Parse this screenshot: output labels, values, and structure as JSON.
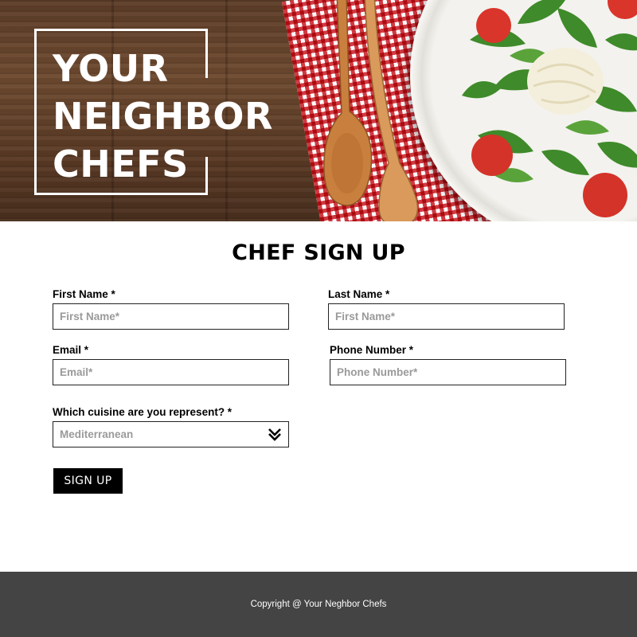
{
  "hero": {
    "title_lines": [
      "YOUR",
      "NEIGHBOR",
      "CHEFS"
    ]
  },
  "form": {
    "heading": "CHEF SIGN UP",
    "first_name": {
      "label": "First Name *",
      "placeholder": "First Name*"
    },
    "last_name": {
      "label": "Last Name *",
      "placeholder": "First Name*"
    },
    "email": {
      "label": "Email *",
      "placeholder": "Email*"
    },
    "phone": {
      "label": "Phone Number *",
      "placeholder": "Phone Number*"
    },
    "cuisine": {
      "label": "Which cuisine are you represent? *",
      "selected": "Mediterranean",
      "icon": "double-chevron-down-icon"
    },
    "submit_label": "SIGN UP"
  },
  "footer": {
    "copyright": "Copyright @ Your Neghbor Chefs"
  },
  "colors": {
    "footer_bg": "#444444",
    "button_bg": "#000000",
    "placeholder_text": "#9a9a9a"
  }
}
